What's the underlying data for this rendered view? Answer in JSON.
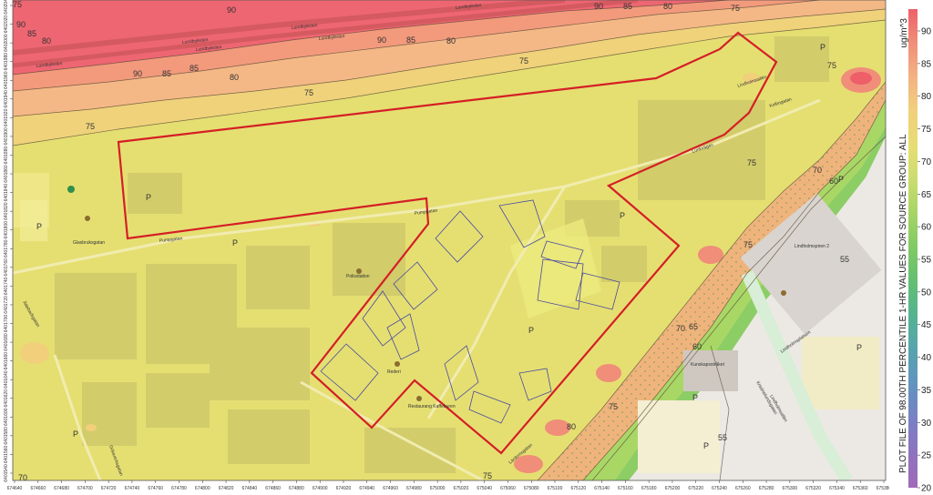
{
  "legend": {
    "unit": "ug/m^3",
    "title": "PLOT FILE OF 98.00TH PERCENTILE 1-HR VALUES FOR SOURCE GROUP: ALL",
    "ticks": [
      "90",
      "85",
      "80",
      "75",
      "70",
      "65",
      "60",
      "55",
      "50",
      "45",
      "40",
      "35",
      "30",
      "25",
      "20"
    ],
    "colors": {
      "c90": "#ee5f6a",
      "c85": "#f08e79",
      "c80": "#f4b183",
      "c75": "#f1cf7b",
      "c70": "#e6de74",
      "c65": "#c9dc6f",
      "c60": "#a4d465",
      "c55": "#7fca64",
      "c50": "#62bf73",
      "c45": "#55b390",
      "c40": "#56a4ae",
      "c35": "#6392c0",
      "c30": "#7a80c4",
      "c25": "#8f72bf",
      "c20": "#a06ab8"
    }
  },
  "contours": {
    "top": [
      "75",
      "90",
      "85",
      "80",
      "85",
      "90",
      "90",
      "85",
      "80",
      "75",
      "90",
      "85",
      "80",
      "75",
      "75",
      "90",
      "85",
      "80"
    ],
    "left_75": "75",
    "right": [
      "75",
      "70",
      "60",
      "75",
      "55",
      "70",
      "65",
      "60",
      "75",
      "80",
      "55",
      "75"
    ],
    "bottom": [
      "70",
      "75"
    ]
  },
  "x_ticks": [
    "674640",
    "674660",
    "674680",
    "674700",
    "674720",
    "674740",
    "674760",
    "674780",
    "674800",
    "674820",
    "674840",
    "674860",
    "674880",
    "674900",
    "674920",
    "674940",
    "674960",
    "674980",
    "675000",
    "675020",
    "675040",
    "675060",
    "675080",
    "675100",
    "675120",
    "675140",
    "675160",
    "675180",
    "675200",
    "675220",
    "675240",
    "675260",
    "675280",
    "675300",
    "675320",
    "675340",
    "675360",
    "675380"
  ],
  "y_ticks": [
    "6402040",
    "6402020",
    "6402000",
    "6401980",
    "6401960",
    "6401940",
    "6401920",
    "6401900",
    "6401880",
    "6401860",
    "6401840",
    "6401820",
    "6401800",
    "6401780",
    "6401760",
    "6401740",
    "6401720",
    "6401700",
    "6401680",
    "6401660",
    "6401640",
    "6401620",
    "6401600",
    "6401580",
    "6401560",
    "6401540"
  ],
  "map_labels": {
    "roads": [
      "Lundbyleden",
      "Lundbyleden",
      "Lundbyleden",
      "Lundbyleden",
      "Lundbyleden",
      "Lundbyleden",
      "Pumpgatan",
      "Pumpgatan",
      "Ättebackgatan",
      "Lunkvägen",
      "Lindholmsallén",
      "Kolbogatan",
      "Lindholmsallén",
      "Lindholmsplatsen",
      "Lärdomsgatan"
    ],
    "pois": [
      "Glasbruksgatan",
      "Polisstation",
      "Rederi",
      "Restaurang Kaffeburen",
      "Kunskapsstråket",
      "Kristinelundsgatan",
      "Lindholmspiren 2",
      "Götaverksgatan"
    ],
    "parking": [
      "P",
      "P",
      "P",
      "P",
      "P",
      "P",
      "P",
      "P",
      "P",
      "P",
      "P"
    ]
  }
}
